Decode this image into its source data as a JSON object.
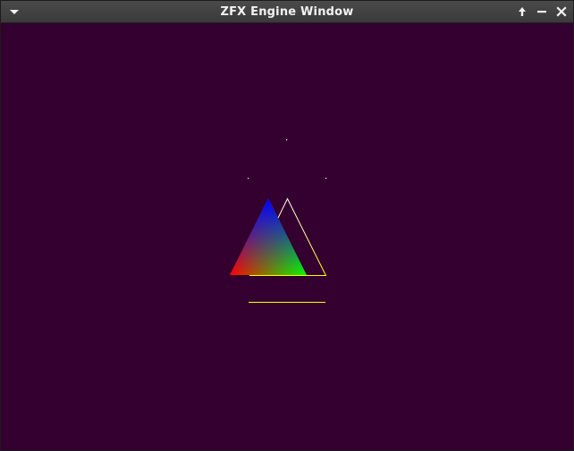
{
  "window": {
    "title": "ZFX Engine Window"
  },
  "titlebar": {
    "buttons": [
      {
        "name": "window-menu",
        "icon": "chevron-down-icon"
      },
      {
        "name": "maximize",
        "icon": "arrow-up-icon"
      },
      {
        "name": "minimize",
        "icon": "minus-icon"
      },
      {
        "name": "close",
        "icon": "close-icon"
      }
    ]
  },
  "scene": {
    "clear_color": "#33002f",
    "filled_triangle_colors": {
      "apex": "#0000ff",
      "left": "#ff0000",
      "right": "#00ff00"
    },
    "wire_triangle_color_top": "#ffffff",
    "wire_triangle_color_bottom": "#ffff00",
    "line_color": "#ffff00",
    "point_color": "#ffffff"
  }
}
